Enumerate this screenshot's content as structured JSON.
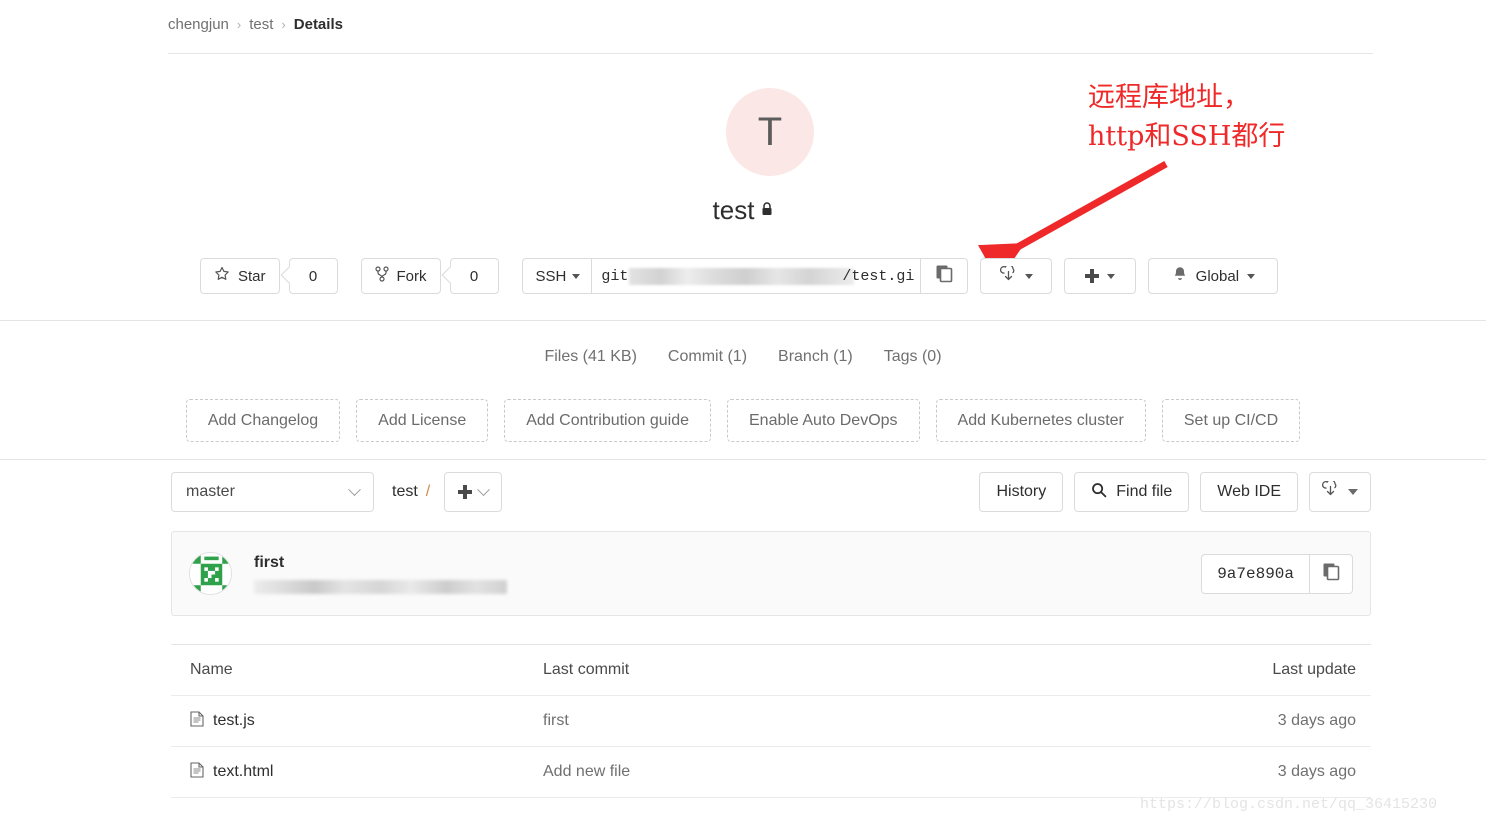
{
  "breadcrumb": {
    "items": [
      {
        "label": "chengjun"
      },
      {
        "label": "test"
      },
      {
        "label": "Details"
      }
    ],
    "separator": "›"
  },
  "project": {
    "avatar_initial": "T",
    "avatar_color": "#fae7e6",
    "name": "test",
    "visibility_icon": "lock-icon"
  },
  "annotation": {
    "line1": "远程库地址，",
    "line2": "http和SSH都行",
    "color": "#ef2929",
    "arrow_icon": "arrow-icon"
  },
  "actionbar": {
    "star": {
      "label": "Star",
      "icon": "star-icon",
      "count": "0"
    },
    "fork": {
      "label": "Fork",
      "icon": "fork-icon",
      "count": "0"
    },
    "clone": {
      "protocol": "SSH",
      "url_prefix": "git",
      "url_suffix": "/test.gi",
      "copy_icon": "copy-icon"
    },
    "download": {
      "icon": "download-cloud-icon"
    },
    "add": {
      "icon": "plus-icon"
    },
    "notification": {
      "icon": "bell-icon",
      "label": "Global"
    }
  },
  "stats": [
    {
      "label": "Files (41 KB)"
    },
    {
      "label": "Commit (1)"
    },
    {
      "label": "Branch (1)"
    },
    {
      "label": "Tags (0)"
    }
  ],
  "quick_actions": [
    {
      "label": "Add Changelog"
    },
    {
      "label": "Add License"
    },
    {
      "label": "Add Contribution guide"
    },
    {
      "label": "Enable Auto DevOps"
    },
    {
      "label": "Add Kubernetes cluster"
    },
    {
      "label": "Set up CI/CD"
    }
  ],
  "repo_toolbar": {
    "branch": "master",
    "path_root": "test",
    "path_separator": "/",
    "history_label": "History",
    "find_file_label": "Find file",
    "find_file_icon": "search-icon",
    "web_ide_label": "Web IDE",
    "download_icon": "download-cloud-icon"
  },
  "last_commit": {
    "avatar_icon": "identicon-avatar",
    "title": "first",
    "hash": "9a7e890a",
    "copy_icon": "copy-icon"
  },
  "file_table": {
    "columns": {
      "name": "Name",
      "last_commit": "Last commit",
      "last_update": "Last update"
    },
    "rows": [
      {
        "icon": "file-icon",
        "name": "test.js",
        "last_commit": "first",
        "last_update": "3 days ago"
      },
      {
        "icon": "file-icon",
        "name": "text.html",
        "last_commit": "Add new file",
        "last_update": "3 days ago"
      }
    ]
  },
  "watermark": "https://blog.csdn.net/qq_36415230"
}
